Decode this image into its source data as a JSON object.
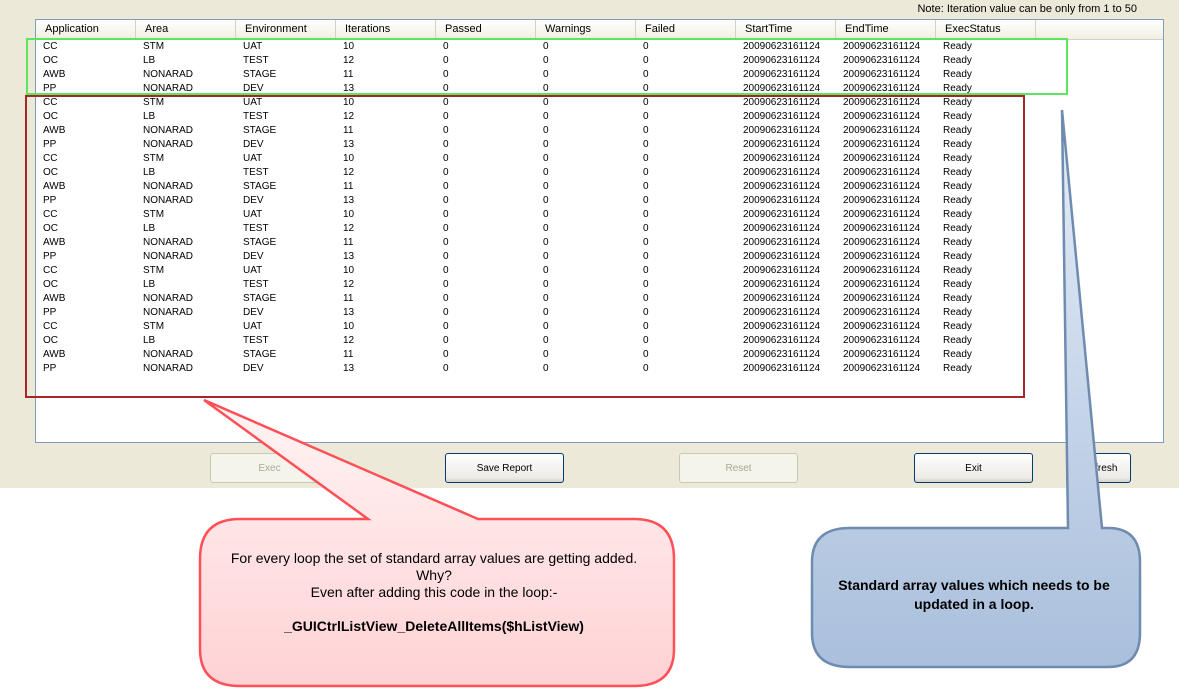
{
  "note": "Note: Iteration value can be only from 1 to 50",
  "listview": {
    "columns": [
      "Application",
      "Area",
      "Environment",
      "Iterations",
      "Passed",
      "Warnings",
      "Failed",
      "StartTime",
      "EndTime",
      "ExecStatus"
    ],
    "rows": [
      [
        "CC",
        "STM",
        "UAT",
        "10",
        "0",
        "0",
        "0",
        "20090623161124",
        "20090623161124",
        "Ready"
      ],
      [
        "OC",
        "LB",
        "TEST",
        "12",
        "0",
        "0",
        "0",
        "20090623161124",
        "20090623161124",
        "Ready"
      ],
      [
        "AWB",
        "NONARAD",
        "STAGE",
        "11",
        "0",
        "0",
        "0",
        "20090623161124",
        "20090623161124",
        "Ready"
      ],
      [
        "PP",
        "NONARAD",
        "DEV",
        "13",
        "0",
        "0",
        "0",
        "20090623161124",
        "20090623161124",
        "Ready"
      ],
      [
        "CC",
        "STM",
        "UAT",
        "10",
        "0",
        "0",
        "0",
        "20090623161124",
        "20090623161124",
        "Ready"
      ],
      [
        "OC",
        "LB",
        "TEST",
        "12",
        "0",
        "0",
        "0",
        "20090623161124",
        "20090623161124",
        "Ready"
      ],
      [
        "AWB",
        "NONARAD",
        "STAGE",
        "11",
        "0",
        "0",
        "0",
        "20090623161124",
        "20090623161124",
        "Ready"
      ],
      [
        "PP",
        "NONARAD",
        "DEV",
        "13",
        "0",
        "0",
        "0",
        "20090623161124",
        "20090623161124",
        "Ready"
      ],
      [
        "CC",
        "STM",
        "UAT",
        "10",
        "0",
        "0",
        "0",
        "20090623161124",
        "20090623161124",
        "Ready"
      ],
      [
        "OC",
        "LB",
        "TEST",
        "12",
        "0",
        "0",
        "0",
        "20090623161124",
        "20090623161124",
        "Ready"
      ],
      [
        "AWB",
        "NONARAD",
        "STAGE",
        "11",
        "0",
        "0",
        "0",
        "20090623161124",
        "20090623161124",
        "Ready"
      ],
      [
        "PP",
        "NONARAD",
        "DEV",
        "13",
        "0",
        "0",
        "0",
        "20090623161124",
        "20090623161124",
        "Ready"
      ],
      [
        "CC",
        "STM",
        "UAT",
        "10",
        "0",
        "0",
        "0",
        "20090623161124",
        "20090623161124",
        "Ready"
      ],
      [
        "OC",
        "LB",
        "TEST",
        "12",
        "0",
        "0",
        "0",
        "20090623161124",
        "20090623161124",
        "Ready"
      ],
      [
        "AWB",
        "NONARAD",
        "STAGE",
        "11",
        "0",
        "0",
        "0",
        "20090623161124",
        "20090623161124",
        "Ready"
      ],
      [
        "PP",
        "NONARAD",
        "DEV",
        "13",
        "0",
        "0",
        "0",
        "20090623161124",
        "20090623161124",
        "Ready"
      ],
      [
        "CC",
        "STM",
        "UAT",
        "10",
        "0",
        "0",
        "0",
        "20090623161124",
        "20090623161124",
        "Ready"
      ],
      [
        "OC",
        "LB",
        "TEST",
        "12",
        "0",
        "0",
        "0",
        "20090623161124",
        "20090623161124",
        "Ready"
      ],
      [
        "AWB",
        "NONARAD",
        "STAGE",
        "11",
        "0",
        "0",
        "0",
        "20090623161124",
        "20090623161124",
        "Ready"
      ],
      [
        "PP",
        "NONARAD",
        "DEV",
        "13",
        "0",
        "0",
        "0",
        "20090623161124",
        "20090623161124",
        "Ready"
      ],
      [
        "CC",
        "STM",
        "UAT",
        "10",
        "0",
        "0",
        "0",
        "20090623161124",
        "20090623161124",
        "Ready"
      ],
      [
        "OC",
        "LB",
        "TEST",
        "12",
        "0",
        "0",
        "0",
        "20090623161124",
        "20090623161124",
        "Ready"
      ],
      [
        "AWB",
        "NONARAD",
        "STAGE",
        "11",
        "0",
        "0",
        "0",
        "20090623161124",
        "20090623161124",
        "Ready"
      ],
      [
        "PP",
        "NONARAD",
        "DEV",
        "13",
        "0",
        "0",
        "0",
        "20090623161124",
        "20090623161124",
        "Ready"
      ]
    ]
  },
  "buttons": {
    "execute": "Exec",
    "save_report": "Save Report",
    "reset": "Reset",
    "exit": "Exit",
    "refresh": "efresh"
  },
  "annotations": {
    "red_callout": {
      "lines": [
        "For every loop the set of standard array values are getting added.",
        "Why?",
        "Even after adding this code in the loop:-"
      ],
      "code": "_GUICtrlListView_DeleteAllItems($hListView)"
    },
    "blue_callout": {
      "text": "Standard array values which needs to be updated in a loop."
    }
  },
  "colors": {
    "window_bg": "#ece9d8",
    "listview_border": "#7f9db9",
    "green_highlight": "#5ce65c",
    "red_highlight": "#a6262b",
    "red_callout_fill": "#ffe3e3",
    "red_callout_stroke": "#ff4f57",
    "blue_callout_fill": "#c6d6ea",
    "blue_callout_stroke": "#6f8bb0"
  }
}
